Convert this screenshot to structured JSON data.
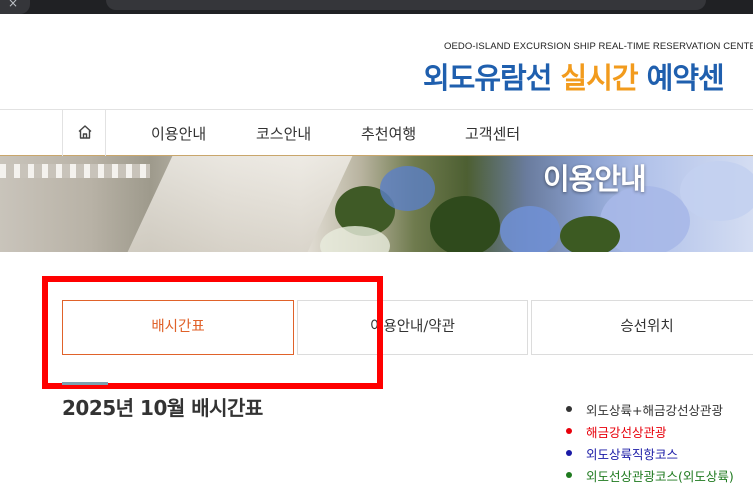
{
  "header": {
    "logo_subtitle": "OEDO-ISLAND EXCURSION SHIP REAL-TIME RESERVATION CENTER",
    "logo_part1": "외도유람선",
    "logo_part2": "실시간",
    "logo_part3": "예약센"
  },
  "nav": {
    "home_icon": "home-icon",
    "items": [
      {
        "label": "이용안내"
      },
      {
        "label": "코스안내"
      },
      {
        "label": "추천여행"
      },
      {
        "label": "고객센터"
      }
    ]
  },
  "banner": {
    "title": "이용안내"
  },
  "tabs": [
    {
      "label": "배시간표",
      "active": true
    },
    {
      "label": "이용안내/약관",
      "active": false
    },
    {
      "label": "승선위치",
      "active": false
    }
  ],
  "section": {
    "title": "2025년 10월 배시간표"
  },
  "legend": [
    {
      "label": "외도상륙+해금강선상관광",
      "color": "#333333"
    },
    {
      "label": "해금강선상관광",
      "color": "#e8000b"
    },
    {
      "label": "외도상륙직항코스",
      "color": "#1a1aa6"
    },
    {
      "label": "외도선상관광코스(외도상륙)",
      "color": "#1f7a1f"
    }
  ],
  "colors": {
    "accent": "#e0622a",
    "highlight": "#ff0000",
    "logo_blue": "#1f5fae",
    "logo_orange": "#f29b1d"
  }
}
